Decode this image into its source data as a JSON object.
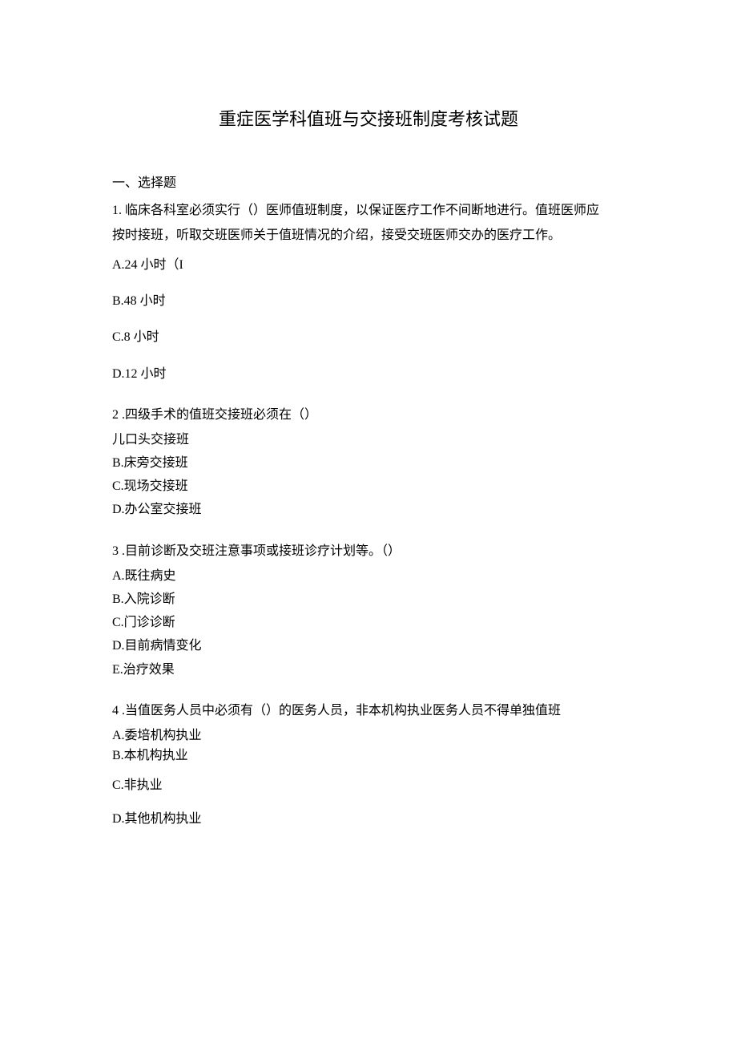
{
  "title": "重症医学科值班与交接班制度考核试题",
  "sectionLabel": "一、选择题",
  "q1": {
    "stem1": "1. 临床各科室必须实行（）医师值班制度，以保证医疗工作不间断地进行。值班医师应",
    "stem2": "按时接班，听取交班医师关于值班情况的介绍，接受交班医师交办的医疗工作。",
    "A": "A.24 小时（I",
    "B": "B.48 小时",
    "C": "C.8 小时",
    "D": "D.12 小时"
  },
  "q2": {
    "stem": "2 .四级手术的值班交接班必须在（）",
    "A": "儿口头交接班",
    "B": "B.床旁交接班",
    "C": "C.现场交接班",
    "D": "D.办公室交接班"
  },
  "q3": {
    "stem": "3 .目前诊断及交班注意事项或接班诊疗计划等。（）",
    "A": "A.既往病史",
    "B": "B.入院诊断",
    "C": "C.门诊诊断",
    "D": "D.目前病情变化",
    "E": "E.治疗效果"
  },
  "q4": {
    "stem": "4 .当值医务人员中必须有（）的医务人员，非本机构执业医务人员不得单独值班",
    "A": "A.委培机构执业",
    "B": "B.本机构执业",
    "C": "C.非执业",
    "D": "D.其他机构执业"
  }
}
